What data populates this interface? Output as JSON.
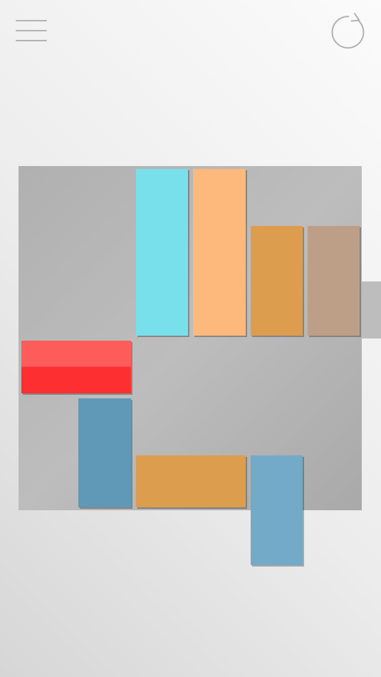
{
  "colors": {
    "target": "#fe3b3b",
    "cyan": "#78e0ea",
    "peach": "#fdb97b",
    "orange": "#dd9d4f",
    "tan": "#bd9f87",
    "steel_blue": "#6098b8",
    "light_blue": "#72aac7",
    "board": "#b5b5b5",
    "icon": "#b2b2b2"
  },
  "toolbar": {
    "menu_icon": "hamburger-menu-icon",
    "restart_icon": "restart-arrow-icon"
  },
  "board": {
    "grid_size": 6,
    "exit_row": 3,
    "blocks": [
      {
        "id": "target-block",
        "orientation": "horizontal",
        "length": 2,
        "row": 3,
        "col": 0,
        "color": "target"
      },
      {
        "id": "cyan-block",
        "orientation": "vertical",
        "length": 3,
        "row": 0,
        "col": 2,
        "color": "cyan"
      },
      {
        "id": "peach-block",
        "orientation": "vertical",
        "length": 3,
        "row": 0,
        "col": 3,
        "color": "peach"
      },
      {
        "id": "orange-vertical-block",
        "orientation": "vertical",
        "length": 2,
        "row": 1,
        "col": 4,
        "color": "orange"
      },
      {
        "id": "tan-block",
        "orientation": "vertical",
        "length": 2,
        "row": 1,
        "col": 5,
        "color": "tan"
      },
      {
        "id": "steel-blue-block",
        "orientation": "vertical",
        "length": 2,
        "row": 4,
        "col": 1,
        "color": "steel_blue"
      },
      {
        "id": "orange-horizontal-block",
        "orientation": "horizontal",
        "length": 2,
        "row": 5,
        "col": 2,
        "color": "orange"
      },
      {
        "id": "light-blue-block",
        "orientation": "vertical",
        "length": 2,
        "row": 5,
        "col": 4,
        "color": "light_blue"
      }
    ]
  }
}
